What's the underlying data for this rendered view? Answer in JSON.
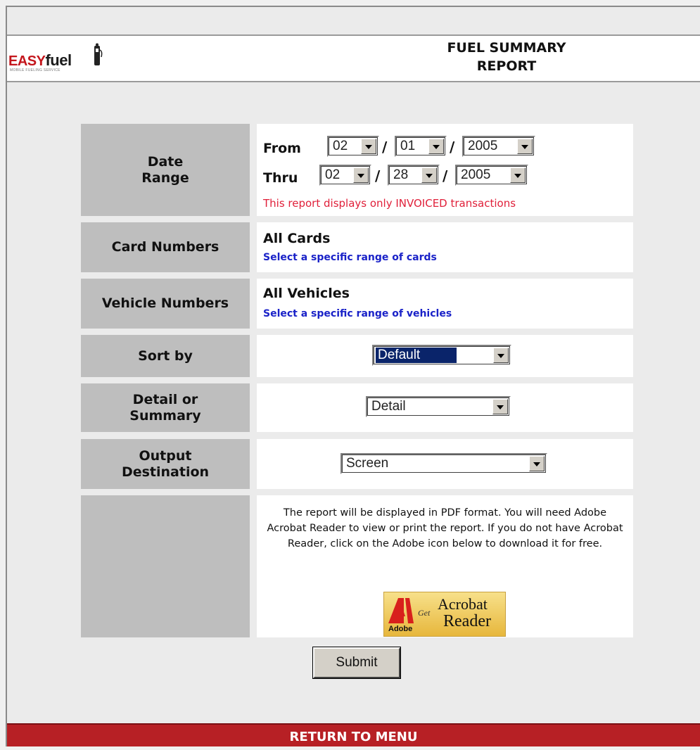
{
  "brand": {
    "logo_main": "EASY",
    "logo_fuel": "fuel",
    "logo_tagline": "MOBILE FUELING SERVICE",
    "accent_color": "#c4161c"
  },
  "header": {
    "title_line1": "FUEL SUMMARY",
    "title_line2": "REPORT"
  },
  "form": {
    "date_range": {
      "label_line1": "Date",
      "label_line2": "Range",
      "from_label": "From",
      "thru_label": "Thru",
      "separator": "/",
      "from": {
        "month": "02",
        "day": "01",
        "year": "2005"
      },
      "thru": {
        "month": "02",
        "day": "28",
        "year": "2005"
      },
      "note": "This report displays only INVOICED transactions",
      "note_color": "#e0203a"
    },
    "cards": {
      "label": "Card Numbers",
      "value": "All Cards",
      "link": "Select a specific range of cards"
    },
    "vehicles": {
      "label": "Vehicle Numbers",
      "value": "All Vehicles",
      "link": "Select a specific range of vehicles"
    },
    "sort": {
      "label": "Sort by",
      "selected": "Default"
    },
    "detail": {
      "label_line1": "Detail or",
      "label_line2": "Summary",
      "selected": "Detail"
    },
    "output": {
      "label_line1": "Output",
      "label_line2": "Destination",
      "selected": "Screen"
    },
    "pdf_note": "The report will be displayed in PDF format. You will need Adobe Acrobat Reader to view or print the report. If you do not have Acrobat Reader, click on the Adobe icon below to download it for free.",
    "adobe_badge": {
      "adobe": "Adobe",
      "get": "Get",
      "acrobat": "Acrobat",
      "reader": "Reader"
    },
    "submit_label": "Submit"
  },
  "footer": {
    "return_label": "RETURN TO MENU",
    "color": "#b72025"
  }
}
